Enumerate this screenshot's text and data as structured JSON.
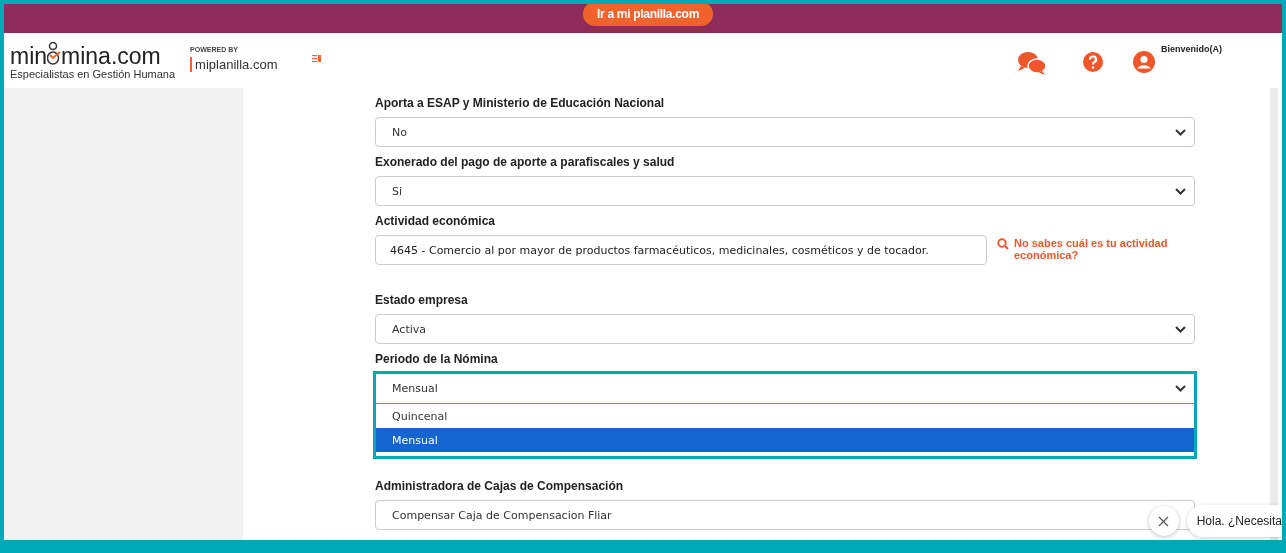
{
  "top_bar": {
    "button": "Ir a mi planilla.com"
  },
  "header": {
    "logo": {
      "name_left": "min",
      "name_right": "mina.com",
      "tagline": "Especialistas en Gestión Humana"
    },
    "powered_by": "POWERED BY",
    "partner": "miplanilla.com",
    "greeting": "Bienvenido(A)"
  },
  "form": [
    {
      "kind": "select",
      "label": "Aporta a ESAP y Ministerio de Educación Nacional",
      "value": "No"
    },
    {
      "kind": "select",
      "label": "Exonerado del pago de aporte a parafiscales y salud",
      "value": "Si"
    },
    {
      "kind": "text",
      "label": "Actividad económica",
      "value": "4645 - Comercio al por mayor de productos farmacéuticos, medicinales, cosméticos y de tocador.",
      "help_link": "No sabes cuál es tu actividad económica?"
    },
    {
      "kind": "select",
      "label": "Estado empresa",
      "value": "Activa"
    },
    {
      "kind": "open_select",
      "label": "Periodo de la Nómina",
      "value": "Mensual",
      "options": [
        {
          "label": "Quincenal",
          "selected": false
        },
        {
          "label": "Mensual",
          "selected": true
        }
      ]
    },
    {
      "kind": "select",
      "label": "Administradora de Cajas de Compensación",
      "value": "Compensar Caja de Compensacion Fliar"
    }
  ],
  "chat": {
    "message": "Hola. ¿Necesita"
  }
}
